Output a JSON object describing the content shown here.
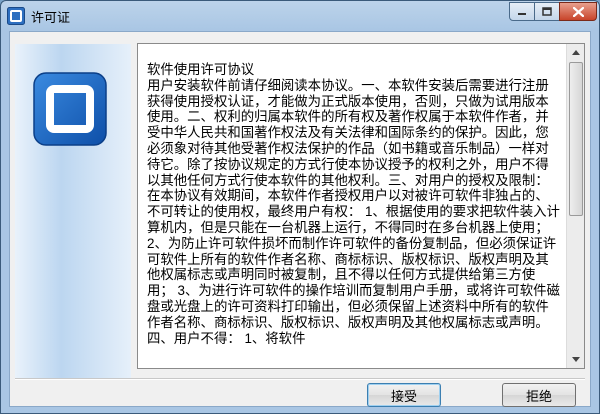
{
  "window": {
    "title": "许可证"
  },
  "license": {
    "text": "软件使用许可协议\n用户安装软件前请仔细阅读本协议。一、本软件安装后需要进行注册获得使用授权认证，才能做为正式版本使用，否则，只做为试用版本使用。二、权利的归属本软件的所有权及著作权属于本软件作者，并受中华人民共和国著作权法及有关法律和国际条约的保护。因此，您必须象对待其他受著作权法保护的作品（如书籍或音乐制品）一样对待它。除了按协议规定的方式行使本协议授予的权利之外，用户不得以其他任何方式行使本软件的其他权利。三、对用户的授权及限制：在本协议有效期间，本软件作者授权用户以对被许可软件非独占的、不可转让的使用权，最终用户有权： 1、根据使用的要求把软件装入计算机内，但是只能在一台机器上运行，不得同时在多台机器上使用； 2、为防止许可软件损坏而制作许可软件的备份复制品，但必须保证许可软件上所有的软件作者名称、商标标识、版权标识、版权声明及其他权属标志或声明同时被复制，且不得以任何方式提供给第三方使用； 3、为进行许可软件的操作培训而复制用户手册，或将许可软件磁盘或光盘上的许可资料打印输出，但必须保留上述资料中所有的软件作者名称、商标标识、版权标识、版权声明及其他权属标志或声明。四、用户不得： 1、将软件"
  },
  "buttons": {
    "accept": "接受",
    "reject": "拒绝"
  },
  "colors": {
    "titlebar": "#a9c6e4",
    "close_button": "#c8442a",
    "side_icon": "#1f5fb0"
  },
  "scroll": {
    "position_fraction": 0.0
  }
}
